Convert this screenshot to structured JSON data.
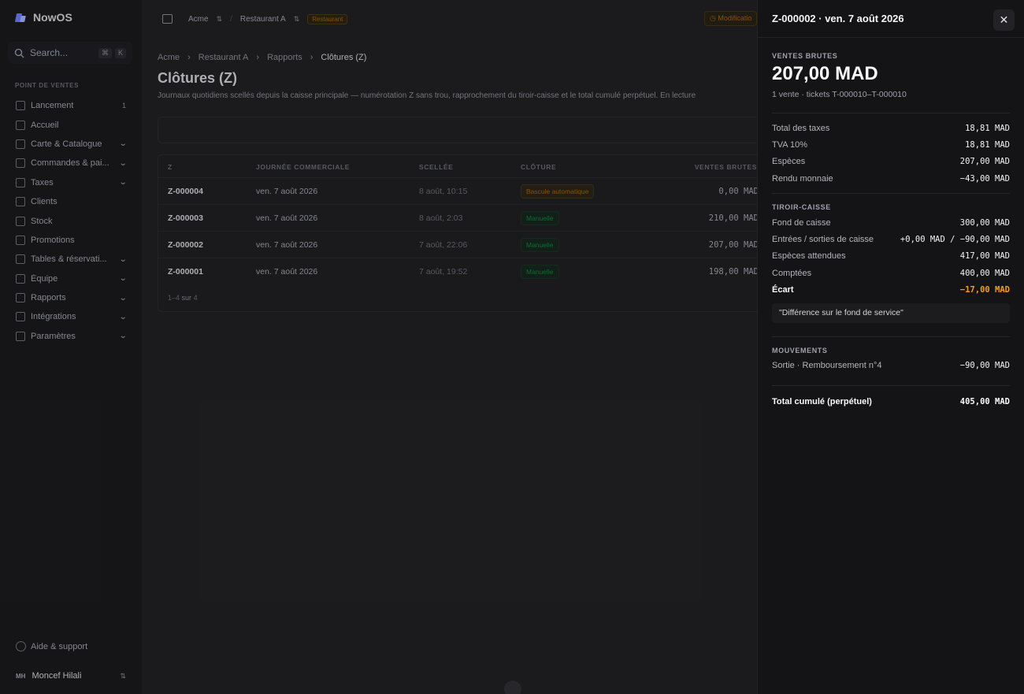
{
  "app": {
    "name": "NowOS"
  },
  "search": {
    "placeholder": "Search...",
    "kbd1": "⌘",
    "kbd2": "K"
  },
  "sidebar": {
    "section": "POINT DE VENTES",
    "items": [
      {
        "label": "Lancement",
        "count": "1",
        "chevron": false,
        "icon": "rocket-icon"
      },
      {
        "label": "Accueil",
        "chevron": false,
        "icon": "home-icon"
      },
      {
        "label": "Carte & Catalogue",
        "chevron": true,
        "icon": "book-icon"
      },
      {
        "label": "Commandes & pai...",
        "chevron": true,
        "icon": "receipt-icon"
      },
      {
        "label": "Taxes",
        "chevron": true,
        "icon": "percent-icon"
      },
      {
        "label": "Clients",
        "chevron": false,
        "icon": "users-icon"
      },
      {
        "label": "Stock",
        "chevron": false,
        "icon": "box-icon"
      },
      {
        "label": "Promotions",
        "chevron": false,
        "icon": "tag-icon"
      },
      {
        "label": "Tables & réservati...",
        "chevron": true,
        "icon": "table-icon"
      },
      {
        "label": "Équipe",
        "chevron": true,
        "icon": "team-icon"
      },
      {
        "label": "Rapports",
        "chevron": true,
        "icon": "chart-icon"
      },
      {
        "label": "Intégrations",
        "chevron": true,
        "icon": "plug-icon"
      },
      {
        "label": "Paramètres",
        "chevron": true,
        "icon": "gear-icon"
      }
    ],
    "help": "Aide & support",
    "user": {
      "initials": "MH",
      "name": "Moncef Hilali"
    }
  },
  "topbar": {
    "org": "Acme",
    "site": "Restaurant A",
    "badge": "Restaurant",
    "modif": "Modificatio"
  },
  "breadcrumb": [
    "Acme",
    "Restaurant A",
    "Rapports",
    "Clôtures (Z)"
  ],
  "page": {
    "title": "Clôtures (Z)",
    "description": "Journaux quotidiens scellés depuis la caisse principale — numérotation Z sans trou, rapprochement du tiroir-caisse et le total cumulé perpétuel. En lecture"
  },
  "table": {
    "headers": {
      "z": "Z",
      "day": "JOURNÉE COMMERCIALE",
      "sealed": "SCELLÉE",
      "closure": "CLÔTURE",
      "gross": "VENTES BRUTES"
    },
    "rows": [
      {
        "z": "Z-000004",
        "day": "ven. 7 août 2026",
        "sealed": "8 août, 10:15",
        "closure": "Bascule automatique",
        "closure_kind": "auto",
        "gross": "0,00 MAD"
      },
      {
        "z": "Z-000003",
        "day": "ven. 7 août 2026",
        "sealed": "8 août, 2:03",
        "closure": "Manuelle",
        "closure_kind": "manual",
        "gross": "210,00 MAD"
      },
      {
        "z": "Z-000002",
        "day": "ven. 7 août 2026",
        "sealed": "7 août, 22:06",
        "closure": "Manuelle",
        "closure_kind": "manual",
        "gross": "207,00 MAD"
      },
      {
        "z": "Z-000001",
        "day": "ven. 7 août 2026",
        "sealed": "7 août, 19:52",
        "closure": "Manuelle",
        "closure_kind": "manual",
        "gross": "198,00 MAD"
      }
    ],
    "pager": {
      "range": "1–4",
      "of": "sur",
      "total": "4"
    }
  },
  "drawer": {
    "title": "Z-000002 · ven. 7 août 2026",
    "gross": {
      "label": "VENTES BRUTES",
      "amount": "207,00 MAD",
      "sub": "1 vente · tickets T-000010–T-000010"
    },
    "taxes": [
      {
        "k": "Total des taxes",
        "v": "18,81 MAD"
      },
      {
        "k": "TVA 10%",
        "v": "18,81 MAD"
      },
      {
        "k": "Espèces",
        "v": "207,00 MAD"
      },
      {
        "k": "Rendu monnaie",
        "v": "−43,00 MAD"
      }
    ],
    "drawer_section": {
      "label": "TIROIR-CAISSE",
      "rows": [
        {
          "k": "Fond de caisse",
          "v": "300,00 MAD"
        },
        {
          "k": "Entrées / sorties de caisse",
          "v": "+0,00 MAD / −90,00 MAD"
        },
        {
          "k": "Espèces attendues",
          "v": "417,00 MAD"
        },
        {
          "k": "Comptées",
          "v": "400,00 MAD"
        }
      ],
      "variance": {
        "k": "Écart",
        "v": "−17,00 MAD"
      },
      "note": "\"Différence sur le fond de service\""
    },
    "movements": {
      "label": "MOUVEMENTS",
      "rows": [
        {
          "k": "Sortie · Remboursement n°4",
          "v": "−90,00 MAD"
        }
      ]
    },
    "cumulative": {
      "k": "Total cumulé (perpétuel)",
      "v": "405,00 MAD"
    }
  },
  "colors": {
    "accent_warning": "#f59e0b",
    "brand": "#6b7cff",
    "manual_green": "#15803d"
  }
}
